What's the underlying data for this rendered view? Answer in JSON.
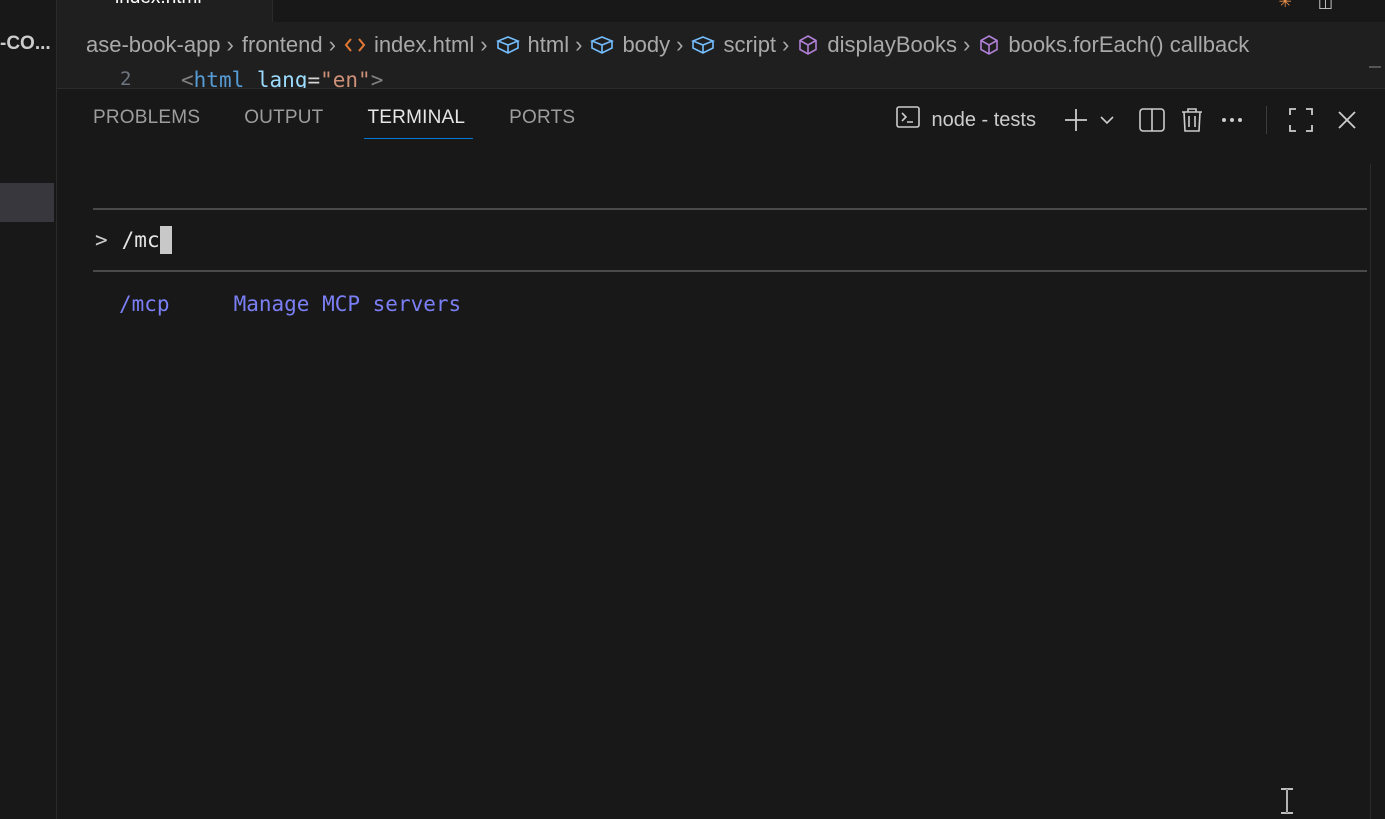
{
  "sidebar": {
    "label": "-CO..."
  },
  "tabs": {
    "active_label": "index.html"
  },
  "breadcrumb": {
    "items": [
      {
        "label": "ase-book-app",
        "icon": null
      },
      {
        "label": "frontend",
        "icon": null
      },
      {
        "label": "index.html",
        "icon": "html-file-icon"
      },
      {
        "label": "html",
        "icon": "element-icon"
      },
      {
        "label": "body",
        "icon": "element-icon"
      },
      {
        "label": "script",
        "icon": "element-icon"
      },
      {
        "label": "displayBooks",
        "icon": "method-icon"
      },
      {
        "label": "books.forEach() callback",
        "icon": "method-icon"
      }
    ]
  },
  "editor": {
    "line_number": "2",
    "code": {
      "open": "<",
      "tag": "html",
      "attr": "lang",
      "eq": "=",
      "value": "\"en\"",
      "close": ">"
    }
  },
  "panel": {
    "tabs": [
      "PROBLEMS",
      "OUTPUT",
      "TERMINAL",
      "PORTS"
    ],
    "active_tab": "TERMINAL",
    "terminal_name": "node - tests"
  },
  "terminal": {
    "prompt_symbol": ">",
    "input": "/mc",
    "suggestion_command": "/mcp",
    "suggestion_description": "Manage MCP servers"
  },
  "colors": {
    "background": "#181818",
    "accent": "#0078d4",
    "suggestion": "#7b7ff5"
  }
}
